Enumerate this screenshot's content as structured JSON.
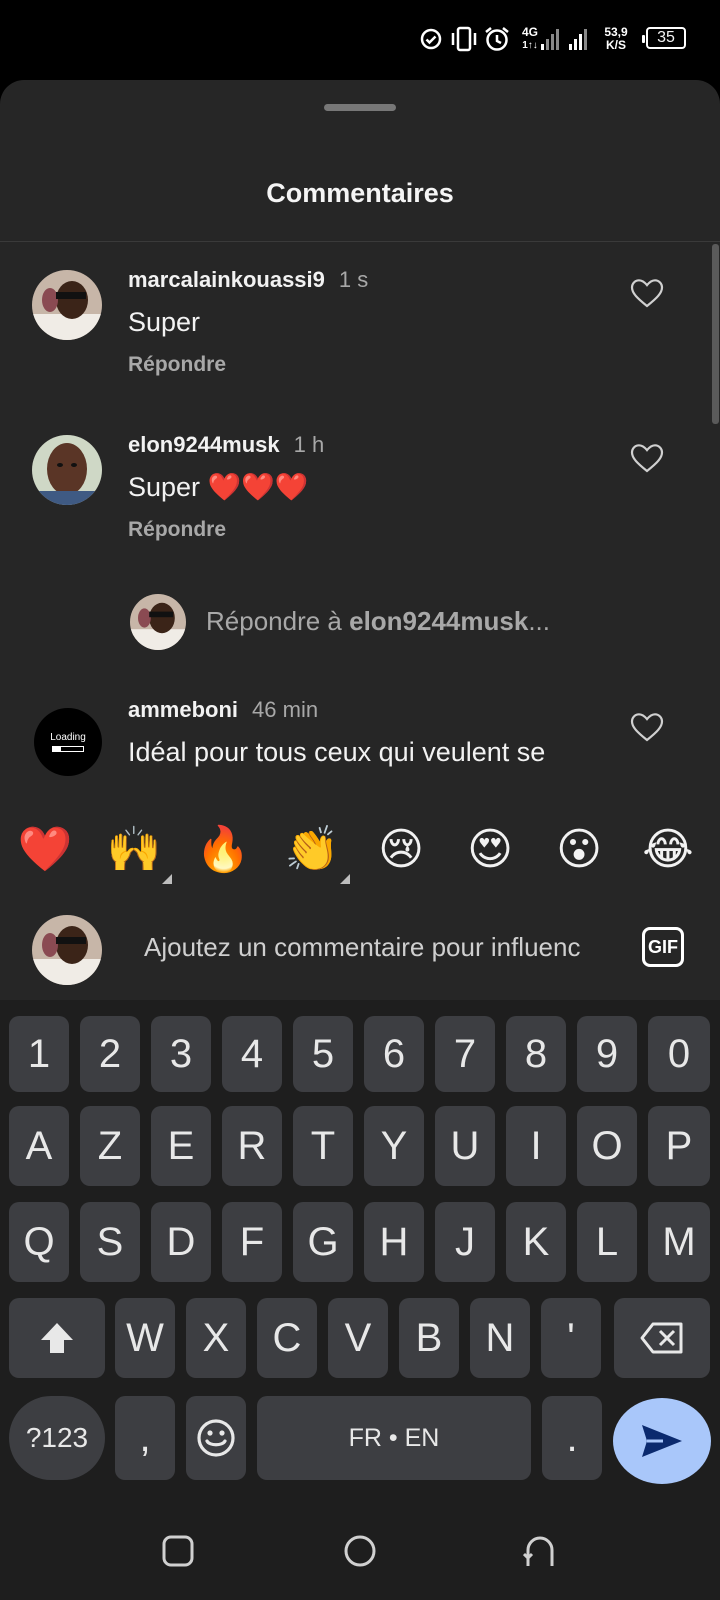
{
  "status_bar": {
    "network_type": "4G",
    "network_sub": "1↑↓",
    "speed_value": "53,9",
    "speed_unit": "K/S",
    "battery": "35"
  },
  "sheet": {
    "title": "Commentaires"
  },
  "comments": [
    {
      "username": "marcalainkouassi9",
      "time": "1 s",
      "text": "Super",
      "reply_label": "Répondre"
    },
    {
      "username": "elon9244musk",
      "time": "1 h",
      "text": "Super ❤️❤️❤️",
      "reply_label": "Répondre"
    },
    {
      "username": "ammeboni",
      "time": "46 min",
      "text": "Idéal pour tous ceux qui veulent se"
    }
  ],
  "reply_prompt": {
    "prefix": "Répondre à ",
    "target": "elon9244musk",
    "suffix": "..."
  },
  "ammeboni_avatar_text": "Loading",
  "emoji_bar": [
    "❤️",
    "🙌",
    "🔥",
    "👏",
    "😢",
    "😍",
    "😮",
    "😂"
  ],
  "comment_input": {
    "placeholder": "Ajoutez un commentaire pour influenc",
    "gif_label": "GIF"
  },
  "keyboard": {
    "row_numbers": [
      "1",
      "2",
      "3",
      "4",
      "5",
      "6",
      "7",
      "8",
      "9",
      "0"
    ],
    "row_1": [
      "A",
      "Z",
      "E",
      "R",
      "T",
      "Y",
      "U",
      "I",
      "O",
      "P"
    ],
    "row_2": [
      "Q",
      "S",
      "D",
      "F",
      "G",
      "H",
      "J",
      "K",
      "L",
      "M"
    ],
    "row_3": [
      "W",
      "X",
      "C",
      "V",
      "B",
      "N",
      "'"
    ],
    "symbols_label": "?123",
    "comma_label": ",",
    "space_label": "FR • EN",
    "period_label": "."
  },
  "colors": {
    "sheet_bg": "#262626",
    "keyboard_bg": "#1e1e1e",
    "key_bg": "#3d3e42",
    "send_bg": "#a9c7fa",
    "secondary_text": "#a8a8a8"
  }
}
